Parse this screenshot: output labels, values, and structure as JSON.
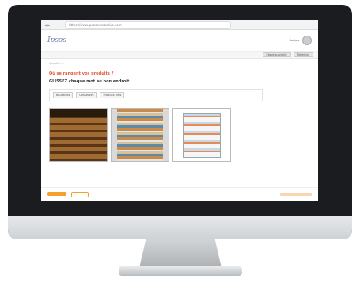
{
  "header": {
    "logo": "Ipsos",
    "url": "https://www.ipsosinteractive.com",
    "user": "Bonjour"
  },
  "subbar": {
    "tabs": [
      "Etape suivante",
      "Terminer"
    ]
  },
  "main": {
    "crumb": "Question 1",
    "question": "Où se rangent vos produits ?",
    "instruction": "GLISSEZ chaque mot au bon endroit.",
    "words": [
      "Bouteilles",
      "Conserves",
      "Produits frais"
    ]
  },
  "images": [
    "wine-cellar",
    "pantry",
    "fridge"
  ]
}
